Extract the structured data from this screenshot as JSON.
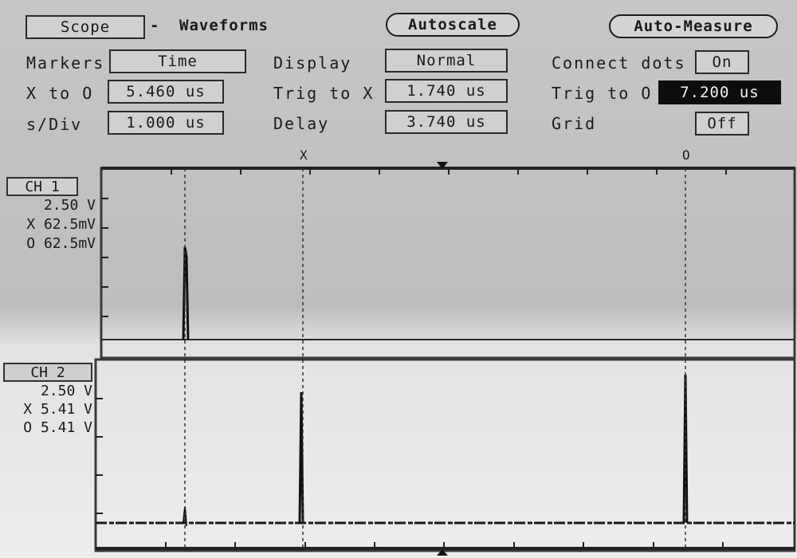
{
  "header": {
    "scope_button": "Scope",
    "dash": "-",
    "title": "Waveforms",
    "autoscale_button": "Autoscale",
    "auto_measure_button": "Auto-Measure"
  },
  "settings": {
    "markers_label": "Markers",
    "markers_value": "Time",
    "x_to_o_label": "X to O",
    "x_to_o_value": "5.460 us",
    "s_div_label": "s/Div",
    "s_div_value": "1.000 us",
    "display_label": "Display",
    "display_value": "Normal",
    "trig_to_x_label": "Trig to X",
    "trig_to_x_value": "1.740 us",
    "delay_label": "Delay",
    "delay_value": "3.740 us",
    "connect_dots_label": "Connect dots",
    "connect_dots_value": "On",
    "trig_to_o_label": "Trig to O",
    "trig_to_o_value": "7.200 us",
    "grid_label": "Grid",
    "grid_value": "Off"
  },
  "markers": {
    "x_marker": "X",
    "o_marker": "O"
  },
  "channel1": {
    "name": "CH 1",
    "volts_div": "2.50 V",
    "x_value": "X 62.5mV",
    "o_value": "O 62.5mV"
  },
  "channel2": {
    "name": "CH 2",
    "volts_div": "2.50 V",
    "x_value": "X 5.41 V",
    "o_value": "O 5.41 V"
  }
}
